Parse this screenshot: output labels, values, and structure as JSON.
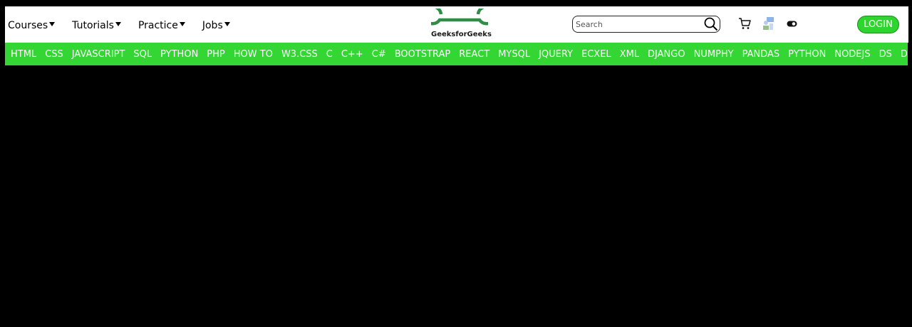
{
  "nav": {
    "items": [
      {
        "label": "Courses"
      },
      {
        "label": "Tutorials"
      },
      {
        "label": "Practice"
      },
      {
        "label": "Jobs"
      }
    ]
  },
  "logo": {
    "text": "GeeksforGeeks",
    "icon": "gfg-logo-icon",
    "color": "#2f8d46"
  },
  "search": {
    "placeholder": "Search",
    "value": "",
    "icon": "search-icon"
  },
  "icons": {
    "cart": "cart-icon",
    "user": "user-icon",
    "theme_toggle": "toggle-icon"
  },
  "login": {
    "label": "LOGIN",
    "color": "#2ed52e"
  },
  "topics": {
    "color": "#33d633",
    "items": [
      {
        "label": "HTML"
      },
      {
        "label": "CSS"
      },
      {
        "label": "JAVASCRIPT"
      },
      {
        "label": "SQL"
      },
      {
        "label": "PYTHON"
      },
      {
        "label": "PHP"
      },
      {
        "label": "HOW TO"
      },
      {
        "label": "W3.CSS"
      },
      {
        "label": "C"
      },
      {
        "label": "C++"
      },
      {
        "label": "C#"
      },
      {
        "label": "BOOTSTRAP"
      },
      {
        "label": "REACT"
      },
      {
        "label": "MYSQL"
      },
      {
        "label": "JQUERY"
      },
      {
        "label": "ECXEL"
      },
      {
        "label": "XML"
      },
      {
        "label": "DJANGO"
      },
      {
        "label": "NUMPHY"
      },
      {
        "label": "PANDAS"
      },
      {
        "label": "PYTHON"
      },
      {
        "label": "NODEJS"
      },
      {
        "label": "DS"
      },
      {
        "label": "DATA"
      }
    ]
  }
}
